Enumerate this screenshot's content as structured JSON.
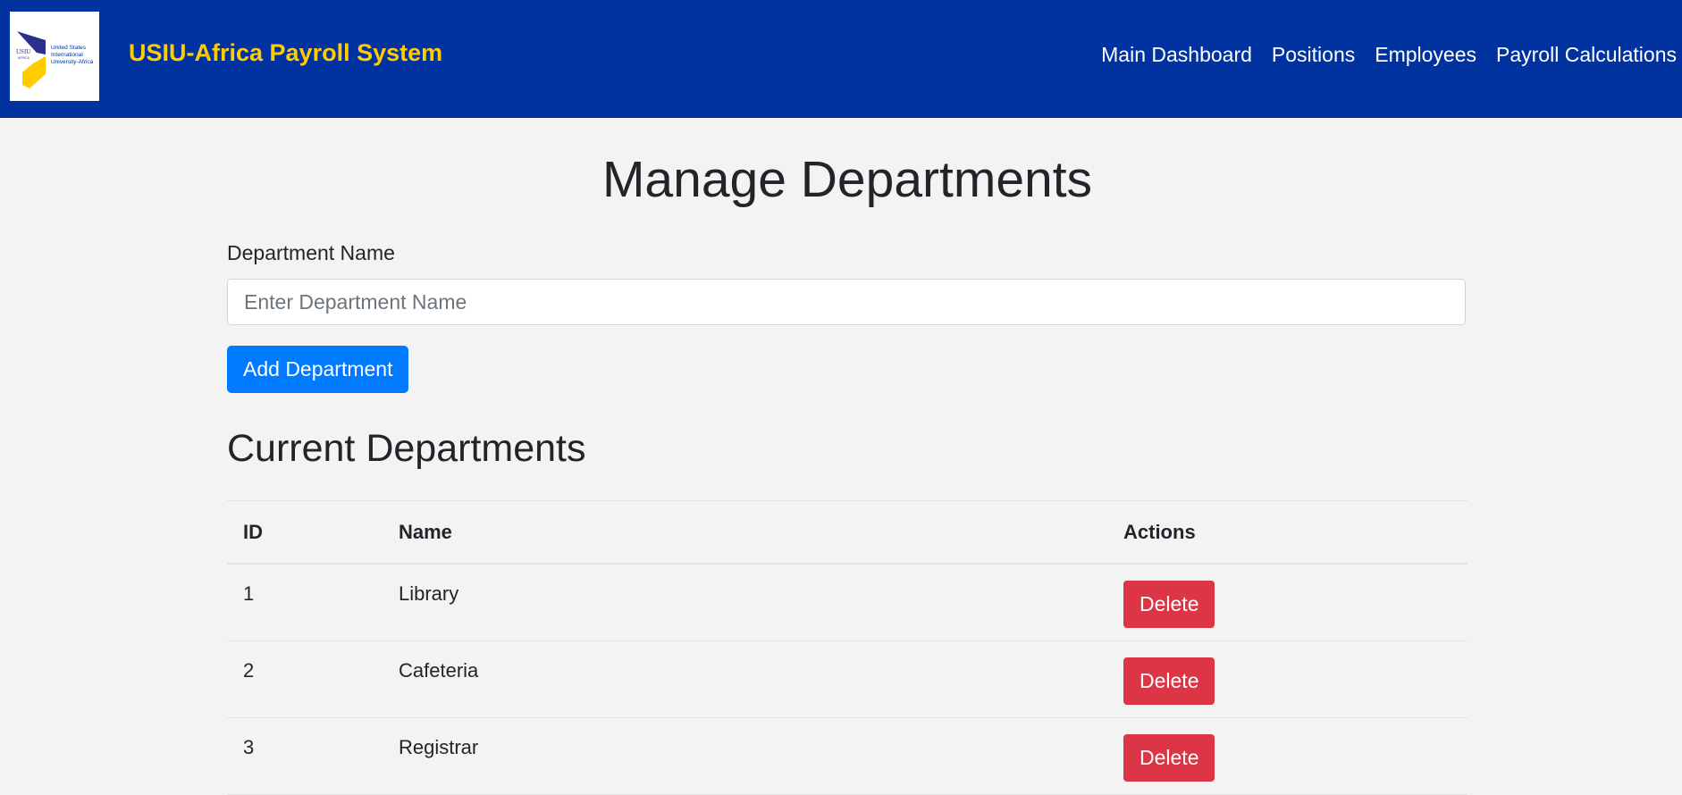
{
  "header": {
    "brand_title": "USIU-Africa Payroll System",
    "logo": {
      "icon": "usiu-logo-icon",
      "line1": "United States",
      "line2": "International",
      "line3": "University-Africa",
      "mark": "USIU",
      "mark_sub": "AFRICA",
      "colors": {
        "navy": "#2b2f8f",
        "yellow": "#ffcc00"
      }
    },
    "nav": [
      {
        "label": "Main Dashboard"
      },
      {
        "label": "Positions"
      },
      {
        "label": "Employees"
      },
      {
        "label": "Payroll Calculations"
      }
    ]
  },
  "main": {
    "title": "Manage Departments",
    "form": {
      "label": "Department Name",
      "placeholder": "Enter Department Name",
      "value": "",
      "submit_label": "Add Department"
    },
    "list_title": "Current Departments",
    "table": {
      "columns": [
        "ID",
        "Name",
        "Actions"
      ],
      "rows": [
        {
          "id": "1",
          "name": "Library",
          "action": "Delete"
        },
        {
          "id": "2",
          "name": "Cafeteria",
          "action": "Delete"
        },
        {
          "id": "3",
          "name": "Registrar",
          "action": "Delete"
        }
      ]
    }
  },
  "colors": {
    "navbar": "#0033a0",
    "brand": "#ffcc00",
    "primary": "#007bff",
    "danger": "#dc3545",
    "background": "#f3f3f3"
  }
}
